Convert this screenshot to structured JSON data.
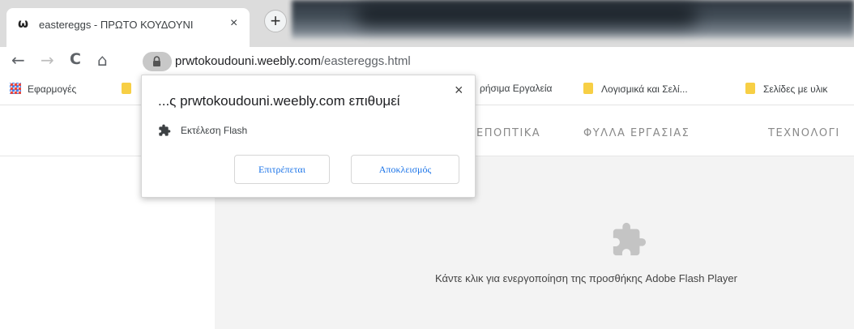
{
  "tab": {
    "favicon": "ѡ",
    "title": "eastereggs - ΠΡΩΤΟ ΚΟΥΔΟΥΝΙ",
    "close": "×",
    "new_tab": "+"
  },
  "toolbar": {
    "back": "←",
    "forward": "→",
    "reload": "C",
    "home": "⌂",
    "url_host": "prwtokoudouni.weebly.com",
    "url_path": "/eastereggs.html"
  },
  "bookmarks": {
    "apps": "Εφαρμογές",
    "items": [
      "ρήσιμα Εργαλεία",
      "Λογισμικά και Σελί...",
      "Σελίδες με υλικ"
    ]
  },
  "site_nav": {
    "items": [
      "ΕΠΟΠΤΙΚΑ",
      "ΦΥΛΛΑ ΕΡΓΑΣΙΑΣ",
      "ΤΕΧΝΟΛΟΓΙ"
    ]
  },
  "popup": {
    "title": "...ς prwtokoudouni.weebly.com επιθυμεί",
    "close": "×",
    "permission": "Εκτέλεση Flash",
    "allow": "Επιτρέπεται",
    "block": "Αποκλεισμός"
  },
  "flash": {
    "message": "Κάντε κλικ για ενεργοποίηση της προσθήκης Adobe Flash Player"
  },
  "colors": {
    "link_blue": "#1a73e8",
    "folder_yellow": "#f7cf45",
    "page_gray": "#f3f3f3"
  }
}
